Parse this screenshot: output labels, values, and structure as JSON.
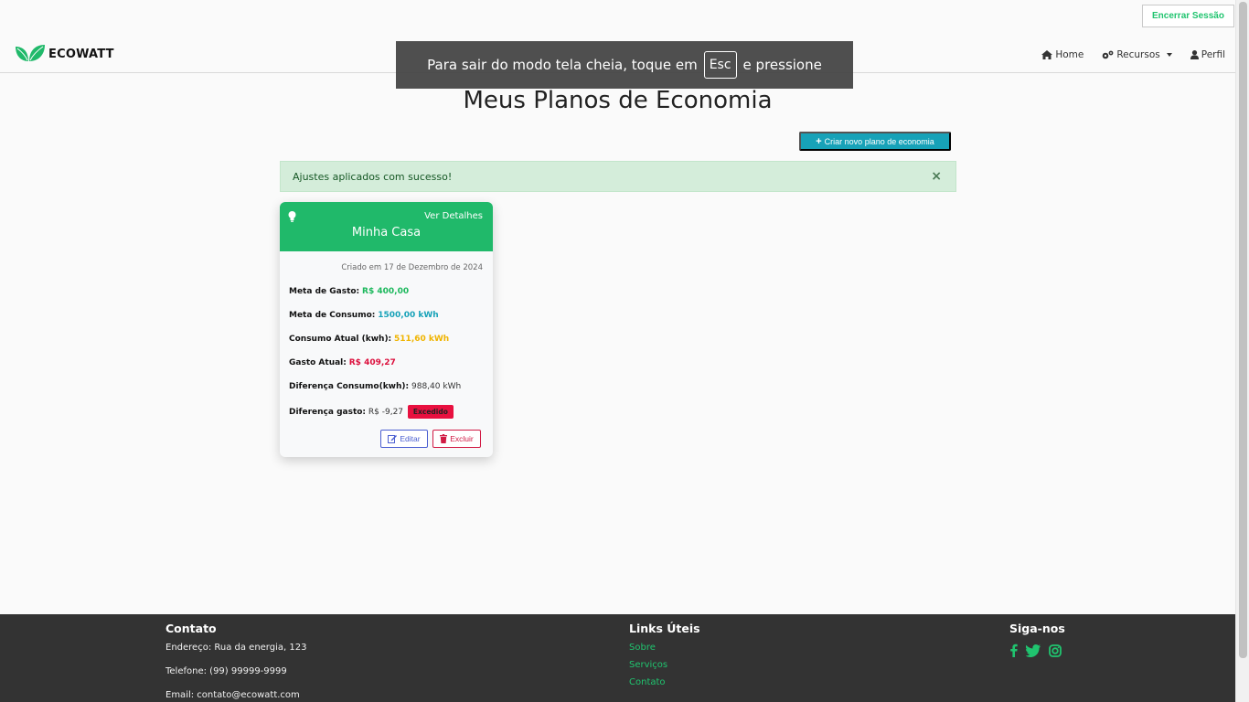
{
  "header": {
    "logout_label": "Encerrar Sessão",
    "brand": "ECOWATT",
    "nav": {
      "home": "Home",
      "resources": "Recursos",
      "profile": "Perfil"
    }
  },
  "fullscreen_notice": {
    "before": "Para sair do modo tela cheia, toque em",
    "key": "Esc",
    "after": "e pressione"
  },
  "page": {
    "title": "Meus Planos de Economia",
    "create_button": "Criar novo plano de economia",
    "alert": "Ajustes aplicados com sucesso!",
    "alert_close": "×"
  },
  "plan_card": {
    "details_link": "Ver Detalhes",
    "title": "Minha Casa",
    "created": "Criado em 17 de Dezembro de 2024",
    "fields": [
      {
        "label": "Meta de Gasto:",
        "value": "R$ 400,00"
      },
      {
        "label": "Meta de Consumo:",
        "value": "1500,00 kWh"
      },
      {
        "label": "Consumo Atual (kwh):",
        "value": "511,60 kWh"
      },
      {
        "label": "Gasto Atual:",
        "value": "R$ 409,27"
      },
      {
        "label": "Diferença Consumo(kwh):",
        "value": "988,40 kWh"
      },
      {
        "label": "Diferença gasto:",
        "value": "R$ -9,27",
        "badge": "Excedido"
      }
    ],
    "edit_label": "Editar",
    "delete_label": "Excluir"
  },
  "footer": {
    "contact": {
      "title": "Contato",
      "address": "Endereço: Rua da energia, 123",
      "phone": "Telefone: (99) 99999-9999",
      "email": "Email: contato@ecowatt.com"
    },
    "links": {
      "title": "Links Úteis",
      "items": [
        "Sobre",
        "Serviços",
        "Contato"
      ]
    },
    "social": {
      "title": "Siga-nos",
      "icons": [
        "facebook-icon",
        "twitter-icon",
        "instagram-icon"
      ]
    }
  },
  "colors": {
    "brand_green": "#20b96a",
    "info": "#17a2b8",
    "danger": "#dc0f3c",
    "footer_bg": "#333333"
  }
}
